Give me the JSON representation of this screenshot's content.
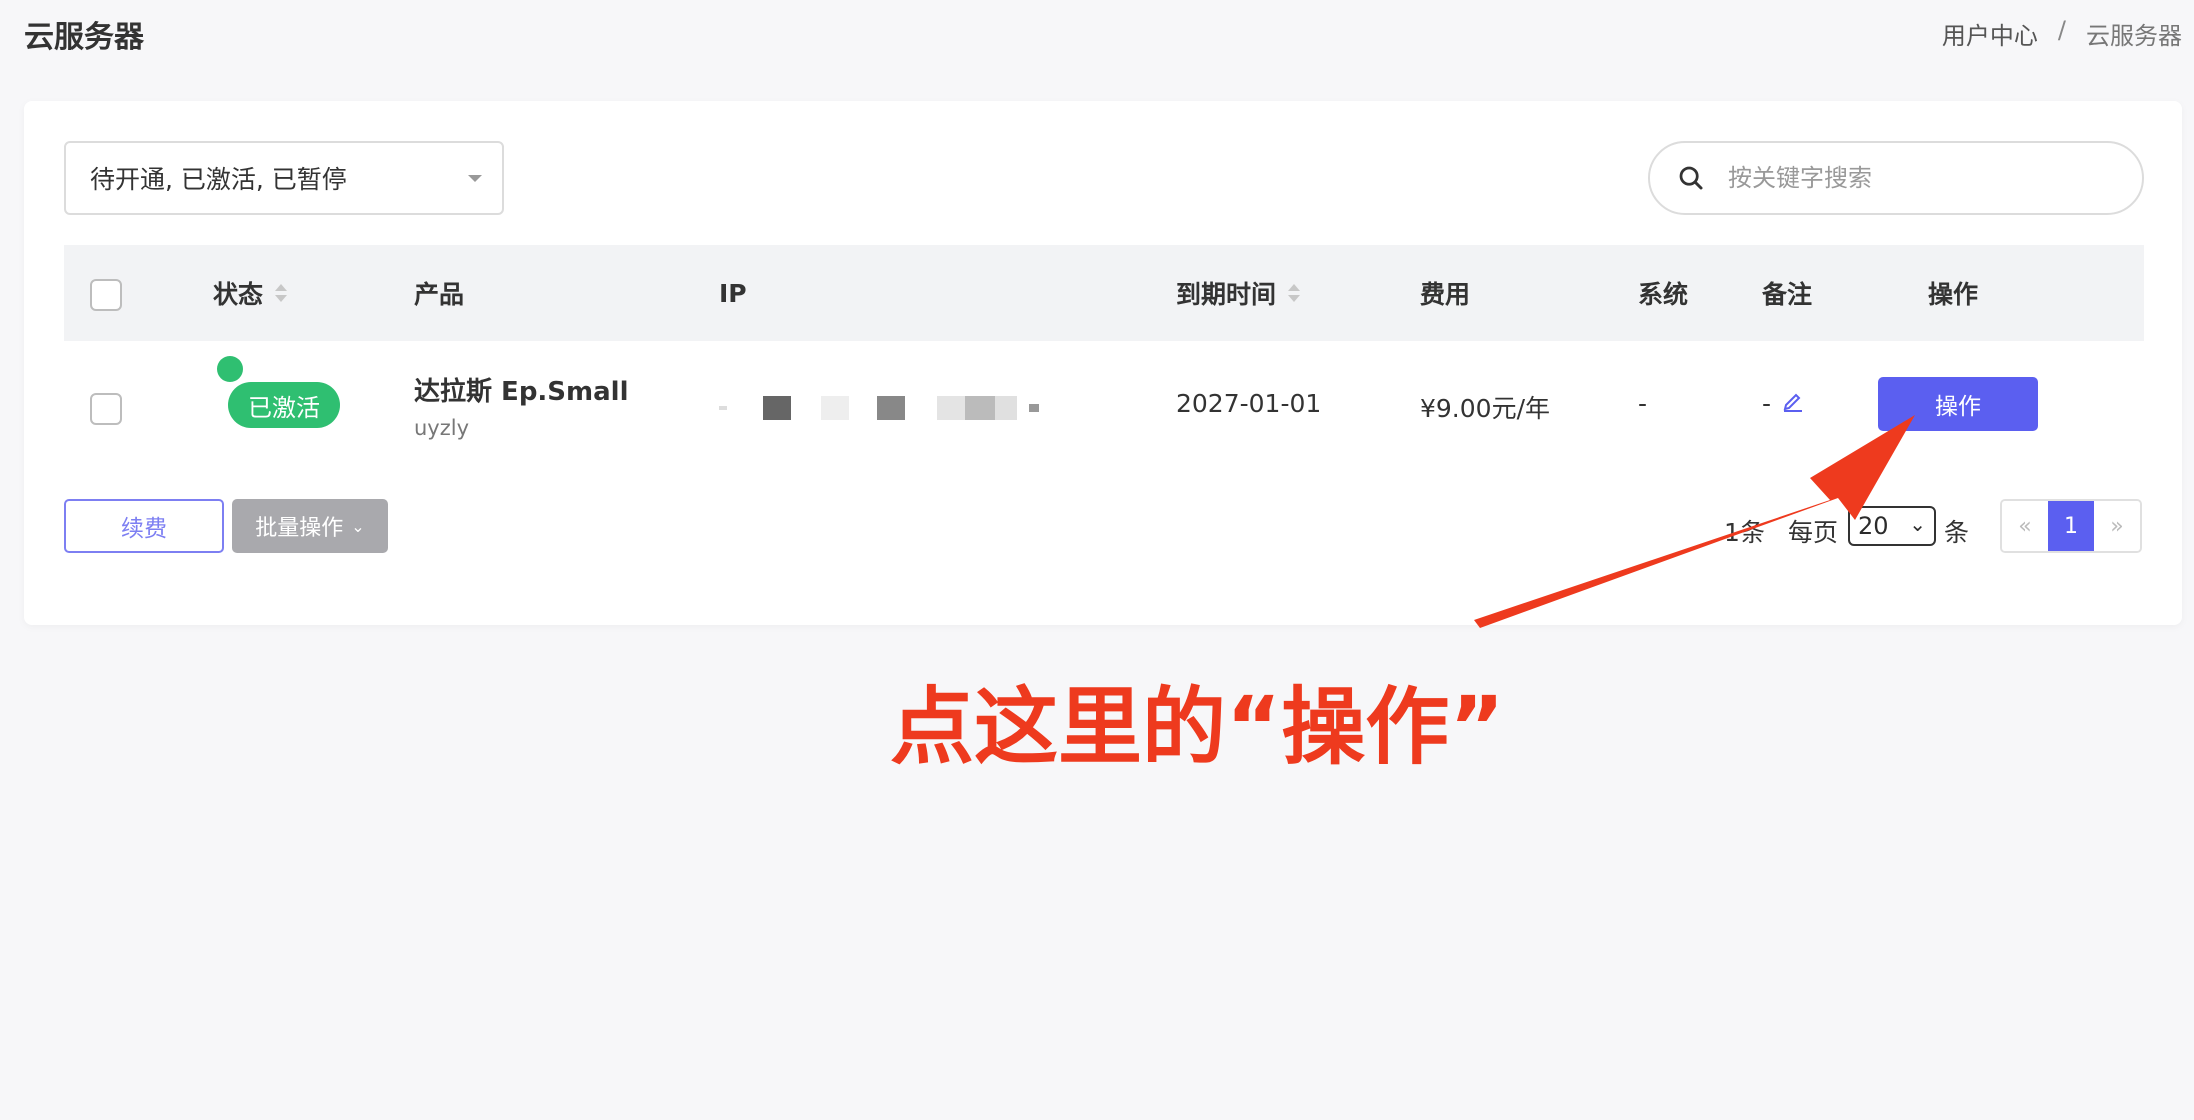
{
  "header": {
    "title": "云服务器",
    "breadcrumb": [
      "用户中心",
      "/",
      "云服务器"
    ]
  },
  "filter": {
    "selected": "待开通, 已激活, 已暂停"
  },
  "search": {
    "placeholder": "按关键字搜索"
  },
  "table": {
    "columns": [
      "状态",
      "产品",
      "IP",
      "到期时间",
      "费用",
      "系统",
      "备注",
      "操作"
    ],
    "rows": [
      {
        "status": "已激活",
        "product_name": "达拉斯 Ep.Small",
        "product_sub": "uyzly",
        "expiry": "2027-01-01",
        "fee": "¥9.00元/年",
        "system": "-",
        "note": "-",
        "action_label": "操作"
      }
    ]
  },
  "footer": {
    "renew_label": "续费",
    "batch_label": "批量操作",
    "total_text": "1条",
    "per_page_label": "每页",
    "per_page_value": "20",
    "per_page_unit": "条",
    "pagination": {
      "prev": "«",
      "current": "1",
      "next": "»"
    }
  },
  "annotation": {
    "text": "点这里的“操作”"
  },
  "colors": {
    "accent": "#5b5ff0",
    "success": "#2fbf71",
    "annotation": "#ee3a1e"
  }
}
